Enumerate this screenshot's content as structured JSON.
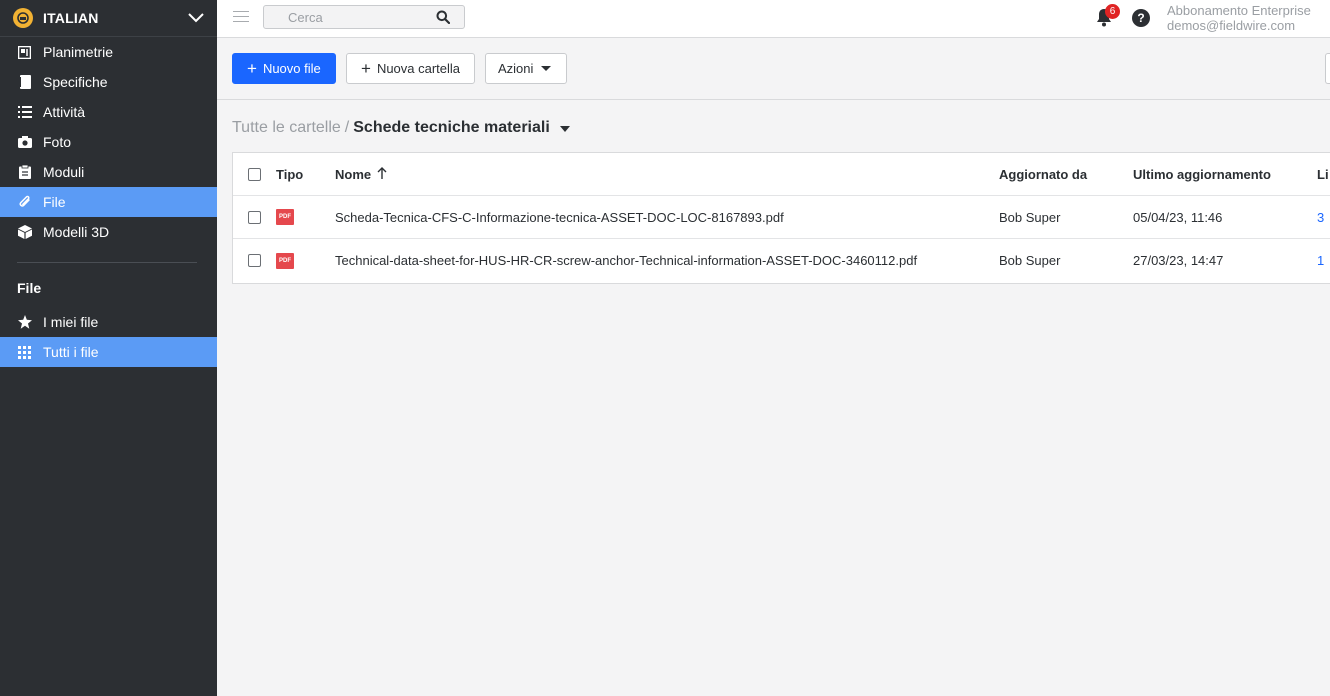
{
  "sidebar": {
    "project_name": "ITALIAN",
    "nav": [
      {
        "label": "Planimetrie",
        "icon": "floorplan-icon"
      },
      {
        "label": "Specifiche",
        "icon": "specs-icon"
      },
      {
        "label": "Attività",
        "icon": "list-icon"
      },
      {
        "label": "Foto",
        "icon": "camera-icon"
      },
      {
        "label": "Moduli",
        "icon": "clipboard-icon"
      },
      {
        "label": "File",
        "icon": "paperclip-icon",
        "active": true
      },
      {
        "label": "Modelli 3D",
        "icon": "cube-icon"
      }
    ],
    "section_title": "File",
    "file_nav": [
      {
        "label": "I miei file",
        "icon": "star-icon"
      },
      {
        "label": "Tutti i file",
        "icon": "grid-icon",
        "active": true
      }
    ]
  },
  "topbar": {
    "search_placeholder": "Cerca",
    "notification_count": "6",
    "help_label": "?",
    "account_plan": "Abbonamento Enterprise",
    "account_email": "demos@fieldwire.com"
  },
  "toolbar": {
    "new_file_label": "Nuovo file",
    "new_folder_label": "Nuova cartella",
    "actions_label": "Azioni"
  },
  "breadcrumb": {
    "parent": "Tutte le cartelle",
    "separator": "/",
    "current": "Schede tecniche materiali"
  },
  "table": {
    "headers": {
      "type": "Tipo",
      "name": "Nome",
      "updated_by": "Aggiornato da",
      "last_updated": "Ultimo aggiornamento",
      "links": "Li"
    },
    "rows": [
      {
        "type": "PDF",
        "name": "Scheda-Tecnica-CFS-C-Informazione-tecnica-ASSET-DOC-LOC-8167893.pdf",
        "updated_by": "Bob Super",
        "last_updated": "05/04/23, 11:46",
        "links": "3"
      },
      {
        "type": "PDF",
        "name": "Technical-data-sheet-for-HUS-HR-CR-screw-anchor-Technical-information-ASSET-DOC-3460112.pdf",
        "updated_by": "Bob Super",
        "last_updated": "27/03/23, 14:47",
        "links": "1"
      }
    ]
  },
  "colors": {
    "sidebar_bg": "#2c2f33",
    "active_bg": "#5b9bf5",
    "primary": "#1a66ff",
    "pdf_red": "#e5484d",
    "badge_red": "#e02424",
    "logo_yellow": "#f2b233"
  }
}
